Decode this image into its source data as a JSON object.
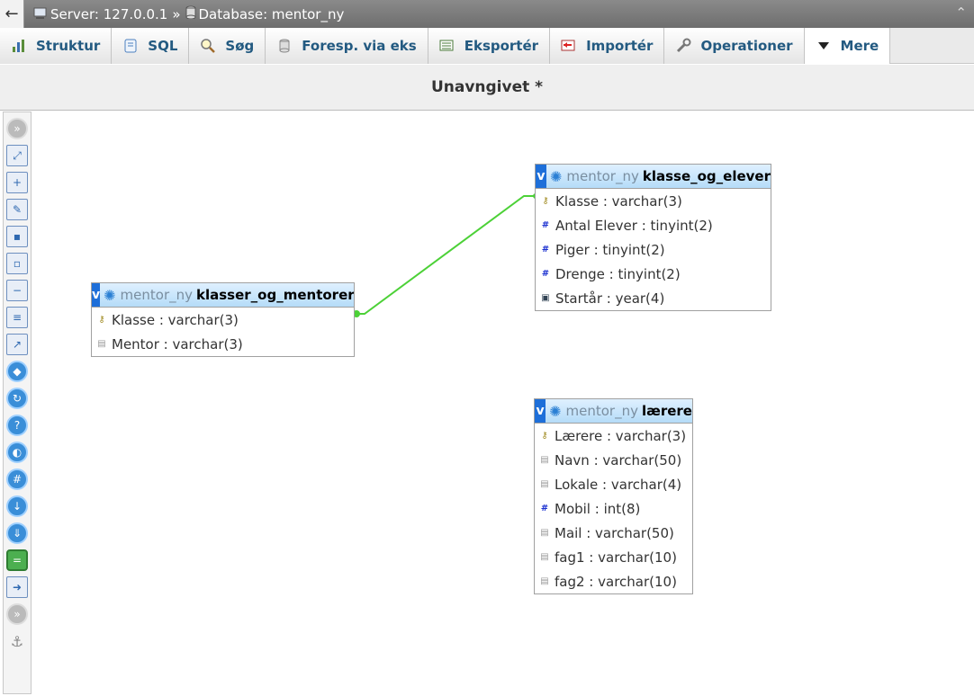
{
  "breadcrumb": {
    "back": "←",
    "server": "Server: 127.0.0.1",
    "separator": "»",
    "database": "Database: mentor_ny"
  },
  "tabs": [
    {
      "label": "Struktur",
      "icon": "structure-icon"
    },
    {
      "label": "SQL",
      "icon": "sql-icon"
    },
    {
      "label": "Søg",
      "icon": "search-icon"
    },
    {
      "label": "Foresp. via eks",
      "icon": "query-icon"
    },
    {
      "label": "Eksportér",
      "icon": "export-icon"
    },
    {
      "label": "Importér",
      "icon": "import-icon"
    },
    {
      "label": "Operationer",
      "icon": "wrench-icon"
    },
    {
      "label": "Mere",
      "icon": "triangle-down-icon"
    }
  ],
  "page_title": "Unavngivet *",
  "tables": {
    "klasser": {
      "db": "mentor_ny",
      "name": "klasser_og_mentorer",
      "columns": [
        "Klasse : varchar(3)",
        "Mentor : varchar(3)"
      ]
    },
    "elever": {
      "db": "mentor_ny",
      "name": "klasse_og_elever",
      "columns": [
        "Klasse : varchar(3)",
        "Antal Elever : tinyint(2)",
        "Piger : tinyint(2)",
        "Drenge : tinyint(2)",
        "Startår : year(4)"
      ]
    },
    "laerere": {
      "db": "mentor_ny",
      "name": "lærere",
      "columns": [
        "Lærere : varchar(3)",
        "Navn : varchar(50)",
        "Lokale : varchar(4)",
        "Mobil : int(8)",
        "Mail : varchar(50)",
        "fag1 : varchar(10)",
        "fag2 : varchar(10)"
      ]
    }
  },
  "colors": {
    "relation_line": "#4cd137",
    "tab_text": "#235a81",
    "header_blue": "#1e6fd9"
  }
}
